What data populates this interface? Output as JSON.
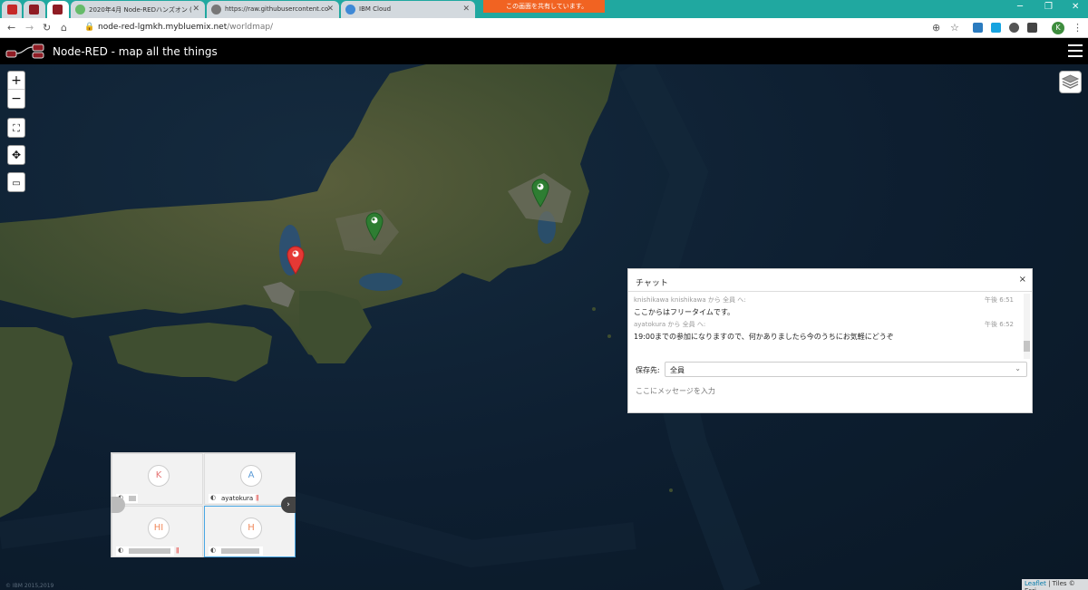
{
  "browser": {
    "tabs": [
      {
        "label": "",
        "icon": "red-square-favicon",
        "color": "#c62828"
      },
      {
        "label": "",
        "icon": "node-red-favicon",
        "color": "#8f1c24"
      },
      {
        "label": "",
        "icon": "node-red-favicon",
        "color": "#8f1c24"
      },
      {
        "label": "2020年4月 Node-REDハンズオン (",
        "icon": "green-favicon",
        "color": "#66bb6a"
      },
      {
        "label": "https://raw.githubusercontent.co",
        "icon": "globe-icon",
        "color": "#555555"
      },
      {
        "label": "IBM Cloud",
        "icon": "ibm-cloud-favicon",
        "color": "#3f89d6"
      }
    ],
    "share_banner": "この画面を共有しています。",
    "url_host": "node-red-lgmkh.mybluemix.net",
    "url_path": "/worldmap/",
    "profile_initial": "K"
  },
  "app": {
    "title": "Node-RED - map all the things",
    "accent": "#000000"
  },
  "map": {
    "controls": [
      "+",
      "−"
    ],
    "markers": [
      {
        "color": "#2e7d32",
        "icon": "map-marker-icon"
      },
      {
        "color": "#2e7d32",
        "icon": "map-marker-icon"
      },
      {
        "color": "#e53935",
        "icon": "map-marker-icon"
      }
    ],
    "attribution_link": "Leaflet",
    "attribution_text": " | Tiles © Esri",
    "copyright": "© IBM 2015,2019"
  },
  "chat": {
    "title": "チャット",
    "close": "×",
    "messages": [
      {
        "meta": "knishikawa knishikawa から 全員 へ:",
        "time": "午後 6:51",
        "text": "ここからはフリータイムです。"
      },
      {
        "meta": "ayatokura から 全員 へ:",
        "time": "午後 6:52",
        "text": "19:00までの参加になりますので、何かありましたら今のうちにお気軽にどうぞ"
      }
    ],
    "to_label": "保存先:",
    "to_value": "全員",
    "input_placeholder": "ここにメッセージを入力"
  },
  "video": {
    "participants": [
      {
        "initial": "K",
        "name": "",
        "color": "#e57373"
      },
      {
        "initial": "A",
        "name": "ayatokura",
        "color": "#5c9bd6"
      },
      {
        "initial": "HI",
        "name": "",
        "color": "#f08a5d"
      },
      {
        "initial": "H",
        "name": "",
        "color": "#f08a5d"
      }
    ],
    "next": "›"
  }
}
